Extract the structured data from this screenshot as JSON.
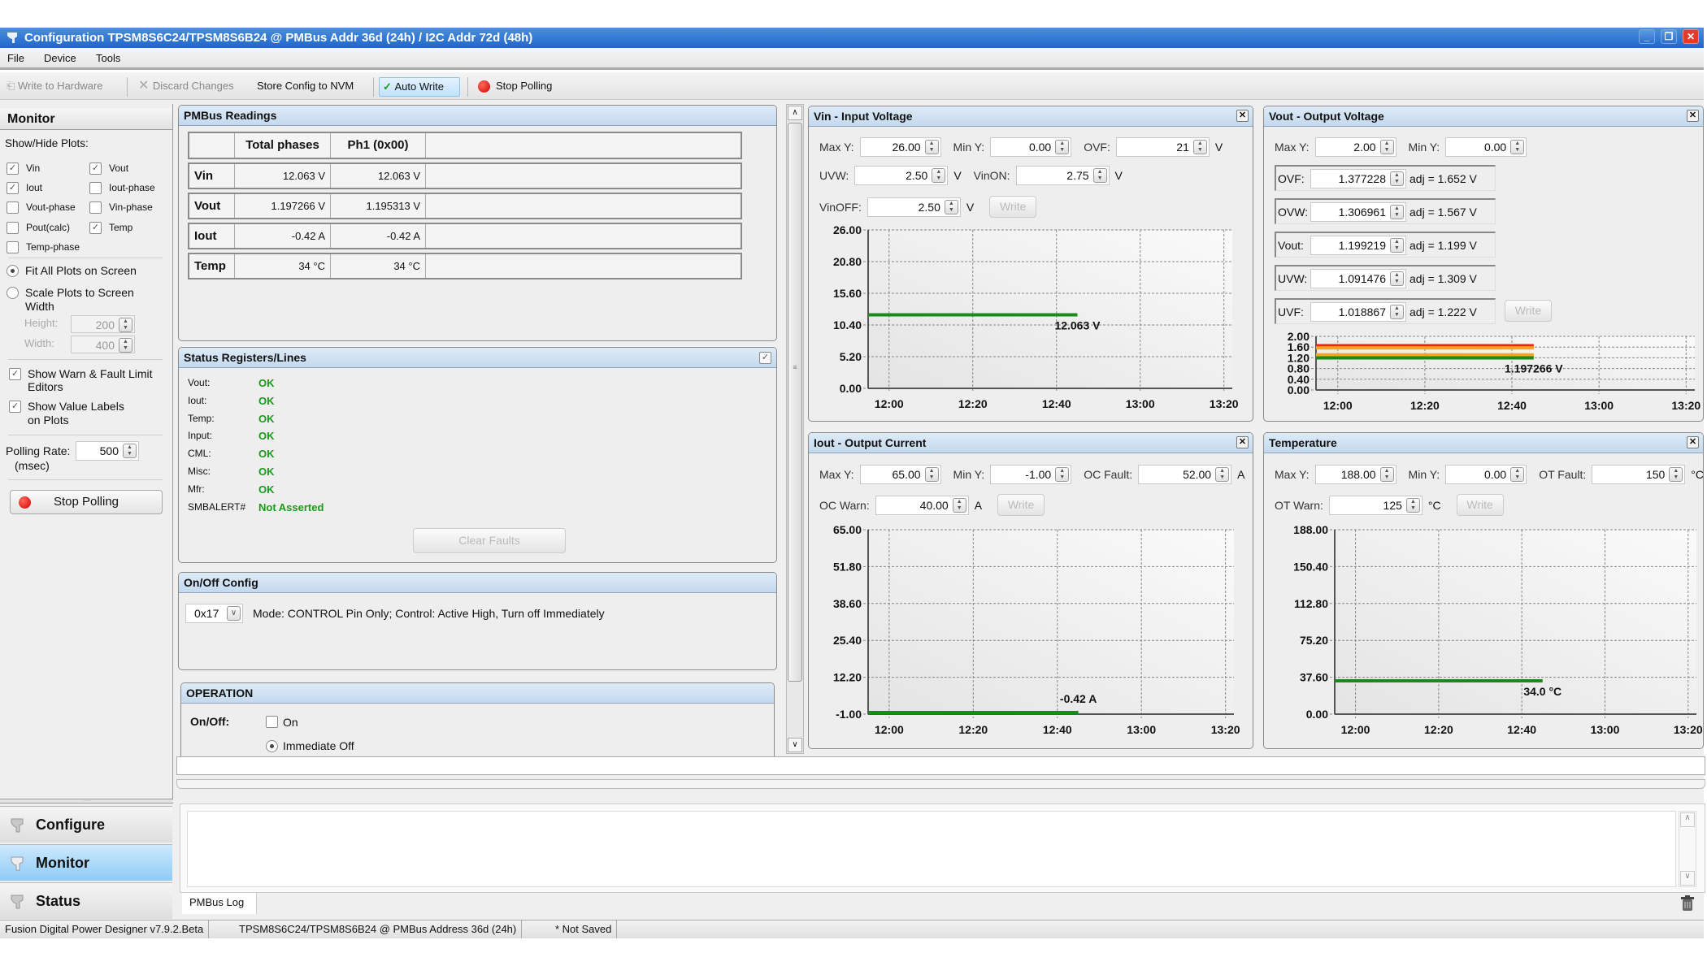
{
  "window": {
    "title": "Configuration TPSM8S6C24/TPSM8S6B24 @ PMBus Addr 36d (24h) / I2C Addr 72d (48h)",
    "minimize": "_",
    "restore": "❐",
    "close": "✕"
  },
  "menu": [
    "File",
    "Device",
    "Tools"
  ],
  "toolbar": {
    "write_to_hardware": "Write to Hardware",
    "discard_changes": "Discard Changes",
    "store_config": "Store Config to NVM",
    "auto_write": "Auto Write",
    "stop_polling": "Stop Polling"
  },
  "monitor": {
    "title": "Monitor",
    "show_hide_label": "Show/Hide Plots:",
    "plots": [
      {
        "label": "Vin",
        "checked": true
      },
      {
        "label": "Vout",
        "checked": true
      },
      {
        "label": "Iout",
        "checked": true
      },
      {
        "label": "Iout-phase",
        "checked": false
      },
      {
        "label": "Vout-phase",
        "checked": false
      },
      {
        "label": "Vin-phase",
        "checked": false
      },
      {
        "label": "Pout(calc)",
        "checked": false
      },
      {
        "label": "Temp",
        "checked": true
      },
      {
        "label": "Temp-phase",
        "checked": false
      }
    ],
    "fit_all": "Fit All Plots on Screen",
    "scale_plots_1": "Scale Plots to Screen",
    "scale_plots_2": "Width",
    "height_label": "Height:",
    "height_value": "200",
    "width_label": "Width:",
    "width_value": "400",
    "show_warn_1": "Show Warn & Fault Limit",
    "show_warn_2": "Editors",
    "show_values_1": "Show Value Labels",
    "show_values_2": "on Plots",
    "polling_label": "Polling Rate:",
    "polling_unit": "(msec)",
    "polling_value": "500",
    "stop_polling": "Stop Polling"
  },
  "nav": [
    {
      "label": "Configure",
      "selected": false
    },
    {
      "label": "Monitor",
      "selected": true
    },
    {
      "label": "Status",
      "selected": false
    }
  ],
  "readings": {
    "title": "PMBus Readings",
    "headers": [
      "",
      "Total phases",
      "Ph1 (0x00)"
    ],
    "rows": [
      {
        "name": "Vin",
        "total": "12.063 V",
        "ph1": "12.063 V"
      },
      {
        "name": "Vout",
        "total": "1.197266 V",
        "ph1": "1.195313 V"
      },
      {
        "name": "Iout",
        "total": "-0.42 A",
        "ph1": "-0.42 A"
      },
      {
        "name": "Temp",
        "total": "34 °C",
        "ph1": "34 °C"
      }
    ]
  },
  "status_registers": {
    "title": "Status Registers/Lines",
    "rows": [
      {
        "label": "Vout:",
        "value": "OK"
      },
      {
        "label": "Iout:",
        "value": "OK"
      },
      {
        "label": "Temp:",
        "value": "OK"
      },
      {
        "label": "Input:",
        "value": "OK"
      },
      {
        "label": "CML:",
        "value": "OK"
      },
      {
        "label": "Misc:",
        "value": "OK"
      },
      {
        "label": "Mfr:",
        "value": "OK"
      },
      {
        "label": "SMBALERT#",
        "value": "Not Asserted"
      }
    ],
    "clear_faults": "Clear Faults",
    "ok_color": "#1a9a1a"
  },
  "onoff_config": {
    "title": "On/Off Config",
    "value": "0x17",
    "description": "Mode: CONTROL Pin Only; Control: Active High, Turn off Immediately"
  },
  "operation": {
    "title": "OPERATION",
    "onoff_label": "On/Off:",
    "on_label": "On",
    "on_checked": false,
    "immediate_off": "Immediate Off",
    "immediate_off_selected": true
  },
  "plot_panels": [
    {
      "title": "Vin - Input Voltage",
      "rows": [
        [
          {
            "label": "Max Y:",
            "value": "26.00"
          },
          {
            "label": "Min Y:",
            "value": "0.00"
          },
          {
            "label": "OVF:",
            "value": "21",
            "unit": "V"
          }
        ],
        [
          {
            "label": "UVW:",
            "value": "2.50",
            "unit": "V"
          },
          {
            "label": "VinON:",
            "value": "2.75",
            "unit": "V"
          }
        ],
        [
          {
            "label": "VinOFF:",
            "value": "2.50",
            "unit": "V"
          }
        ]
      ],
      "write": "Write"
    },
    {
      "title": "Vout - Output Voltage",
      "rows": [
        [
          {
            "label": "Max Y:",
            "value": "2.00"
          },
          {
            "label": "Min Y:",
            "value": "0.00"
          }
        ]
      ],
      "limits": [
        {
          "label": "OVF:",
          "value": "1.377228",
          "adj": "adj = 1.652 V"
        },
        {
          "label": "OVW:",
          "value": "1.306961",
          "adj": "adj = 1.567 V"
        },
        {
          "label": "Vout:",
          "value": "1.199219",
          "adj": "adj = 1.199 V"
        },
        {
          "label": "UVW:",
          "value": "1.091476",
          "adj": "adj = 1.309 V"
        },
        {
          "label": "UVF:",
          "value": "1.018867",
          "adj": "adj = 1.222 V"
        }
      ],
      "write": "Write"
    },
    {
      "title": "Iout - Output Current",
      "rows": [
        [
          {
            "label": "Max Y:",
            "value": "65.00"
          },
          {
            "label": "Min Y:",
            "value": "-1.00"
          },
          {
            "label": "OC Fault:",
            "value": "52.00",
            "unit": "A"
          }
        ],
        [
          {
            "label": "OC Warn:",
            "value": "40.00",
            "unit": "A"
          }
        ]
      ],
      "write": "Write"
    },
    {
      "title": "Temperature",
      "rows": [
        [
          {
            "label": "Max Y:",
            "value": "188.00"
          },
          {
            "label": "Min Y:",
            "value": "0.00"
          },
          {
            "label": "OT Fault:",
            "value": "150",
            "unit": "°C"
          }
        ],
        [
          {
            "label": "OT Warn:",
            "value": "125",
            "unit": "°C"
          }
        ]
      ],
      "write": "Write"
    }
  ],
  "chart_data": [
    {
      "type": "line",
      "ylim": [
        0,
        26
      ],
      "xlim": [
        "11:55",
        "13:22"
      ],
      "y_ticks": [
        "26.00",
        "20.80",
        "15.60",
        "10.40",
        "5.20",
        "0.00"
      ],
      "x_ticks": [
        "12:00",
        "12:20",
        "12:40",
        "13:00",
        "13:20"
      ],
      "grid": true,
      "series": [
        {
          "x": [
            "11:55",
            "12:45"
          ],
          "y": [
            12.063,
            12.063
          ],
          "color": "#1a8a1a"
        }
      ],
      "value_label": "12.063 V"
    },
    {
      "type": "line",
      "ylim": [
        0,
        2
      ],
      "xlim": [
        "11:55",
        "13:22"
      ],
      "y_ticks": [
        "2.00",
        "1.60",
        "1.20",
        "0.80",
        "0.40",
        "0.00"
      ],
      "x_ticks": [
        "12:00",
        "12:20",
        "12:40",
        "13:00",
        "13:20"
      ],
      "grid": true,
      "series": [
        {
          "x": [
            "11:55",
            "12:45"
          ],
          "y": [
            1.652,
            1.652
          ],
          "color": "#e8251b"
        },
        {
          "x": [
            "11:55",
            "12:45"
          ],
          "y": [
            1.567,
            1.567
          ],
          "color": "#f4a521"
        },
        {
          "x": [
            "11:55",
            "12:45"
          ],
          "y": [
            1.309,
            1.309
          ],
          "color": "#f4a521"
        },
        {
          "x": [
            "11:55",
            "12:45"
          ],
          "y": [
            1.197266,
            1.197266
          ],
          "color": "#1a8a1a"
        }
      ],
      "value_label": "1.197266 V"
    },
    {
      "type": "line",
      "ylim": [
        -1,
        65
      ],
      "xlim": [
        "11:55",
        "13:22"
      ],
      "y_ticks": [
        "65.00",
        "51.80",
        "38.60",
        "25.40",
        "12.20",
        "-1.00"
      ],
      "x_ticks": [
        "12:00",
        "12:20",
        "12:40",
        "13:00",
        "13:20"
      ],
      "grid": true,
      "series": [
        {
          "x": [
            "11:55",
            "12:45"
          ],
          "y": [
            -0.42,
            -0.42
          ],
          "color": "#1a8a1a"
        }
      ],
      "value_label": "-0.42 A"
    },
    {
      "type": "line",
      "ylim": [
        0,
        188
      ],
      "xlim": [
        "11:55",
        "13:22"
      ],
      "y_ticks": [
        "188.00",
        "150.40",
        "112.80",
        "75.20",
        "37.60",
        "0.00"
      ],
      "x_ticks": [
        "12:00",
        "12:20",
        "12:40",
        "13:00",
        "13:20"
      ],
      "grid": true,
      "series": [
        {
          "x": [
            "11:55",
            "12:45"
          ],
          "y": [
            34.0,
            34.0
          ],
          "color": "#1a8a1a"
        }
      ],
      "value_label": "34.0 °C"
    }
  ],
  "log": {
    "tab": "PMBus Log"
  },
  "statusbar": [
    "Fusion Digital Power Designer v7.9.2.Beta",
    "TPSM8S6C24/TPSM8S6B24 @ PMBus Address 36d (24h)",
    "* Not Saved"
  ]
}
